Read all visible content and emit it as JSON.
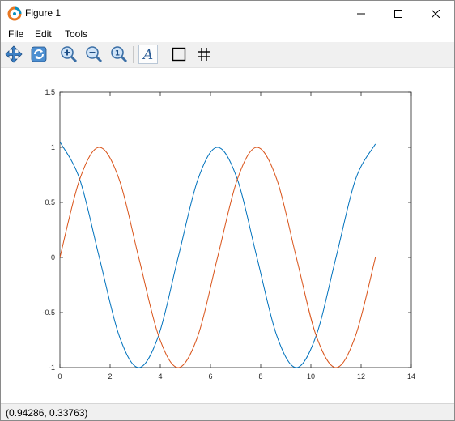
{
  "window": {
    "title": "Figure 1",
    "icon": "octave-logo-icon",
    "controls": [
      "minimize-icon",
      "maximize-icon",
      "close-icon"
    ]
  },
  "menu": {
    "items": [
      {
        "label": "File"
      },
      {
        "label": "Edit"
      },
      {
        "label": "Tools"
      }
    ]
  },
  "toolbar": {
    "tools": [
      {
        "name": "pan-icon"
      },
      {
        "name": "rotate-icon"
      },
      {
        "name": "zoom-in-icon"
      },
      {
        "name": "zoom-out-icon"
      },
      {
        "name": "auto-axes-icon",
        "glyph": "1"
      },
      {
        "name": "text-insert-icon",
        "glyph": "A"
      },
      {
        "name": "toggle-axes-box-icon"
      },
      {
        "name": "toggle-grid-icon"
      }
    ]
  },
  "chart_data": {
    "type": "line",
    "title": "",
    "xlabel": "",
    "ylabel": "",
    "xlim": [
      0,
      14
    ],
    "ylim": [
      -1,
      1.5
    ],
    "x_ticks": [
      0,
      2,
      4,
      6,
      8,
      10,
      12,
      14
    ],
    "x_tick_labels": [
      "0",
      "2",
      "4",
      "6",
      "8",
      "10",
      "12",
      "14"
    ],
    "y_ticks": [
      -1,
      -0.5,
      0,
      0.5,
      1,
      1.5
    ],
    "y_tick_labels": [
      "-1",
      "-0.5",
      "0",
      "0.5",
      "1",
      "1.5"
    ],
    "grid": false,
    "legend": "none",
    "series": [
      {
        "color": "#0072bd",
        "x": [
          0,
          0.79,
          1.57,
          2.36,
          3.14,
          3.93,
          4.71,
          5.5,
          6.28,
          7.07,
          7.85,
          8.64,
          9.42,
          10.21,
          11,
          11.78,
          12.57
        ],
        "y": [
          1.05,
          0.71,
          0,
          -0.71,
          -1,
          -0.71,
          0,
          0.71,
          1,
          0.71,
          0,
          -0.71,
          -1,
          -0.71,
          0,
          0.71,
          1.03
        ]
      },
      {
        "color": "#d95319",
        "x": [
          0,
          0.79,
          1.57,
          2.36,
          3.14,
          3.93,
          4.71,
          5.5,
          6.28,
          7.07,
          7.85,
          8.64,
          9.42,
          10.21,
          11,
          11.78,
          12.57
        ],
        "y": [
          0,
          0.71,
          1,
          0.71,
          0,
          -0.71,
          -1,
          -0.71,
          0,
          0.71,
          1,
          0.71,
          0,
          -0.71,
          -1,
          -0.71,
          0
        ]
      }
    ]
  },
  "status": {
    "coordinates": "(0.94286, 0.33763)"
  }
}
